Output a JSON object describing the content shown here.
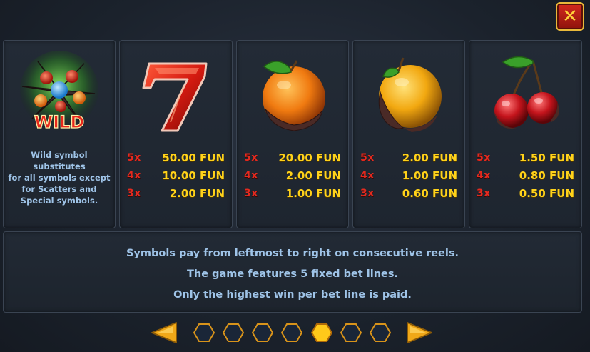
{
  "close": {
    "icon": "close-icon"
  },
  "wild": {
    "symbol_icon": "wild-symbol-icon",
    "label": "WILD",
    "description_lines": [
      "Wild symbol substitutes",
      "for all symbols except",
      "for Scatters and",
      "Special symbols."
    ]
  },
  "symbols": [
    {
      "icon": "seven-symbol-icon",
      "pays": [
        {
          "mult": "5x",
          "amount": "50.00 FUN"
        },
        {
          "mult": "4x",
          "amount": "10.00 FUN"
        },
        {
          "mult": "3x",
          "amount": "2.00 FUN"
        }
      ]
    },
    {
      "icon": "orange-symbol-icon",
      "pays": [
        {
          "mult": "5x",
          "amount": "20.00 FUN"
        },
        {
          "mult": "4x",
          "amount": "2.00 FUN"
        },
        {
          "mult": "3x",
          "amount": "1.00 FUN"
        }
      ]
    },
    {
      "icon": "lemon-symbol-icon",
      "pays": [
        {
          "mult": "5x",
          "amount": "2.00 FUN"
        },
        {
          "mult": "4x",
          "amount": "1.00 FUN"
        },
        {
          "mult": "3x",
          "amount": "0.60 FUN"
        }
      ]
    },
    {
      "icon": "cherry-symbol-icon",
      "pays": [
        {
          "mult": "5x",
          "amount": "1.50 FUN"
        },
        {
          "mult": "4x",
          "amount": "0.80 FUN"
        },
        {
          "mult": "3x",
          "amount": "0.50 FUN"
        }
      ]
    }
  ],
  "info_lines": [
    "Symbols pay from leftmost to right on consecutive reels.",
    "The game features 5 fixed bet lines.",
    "Only the highest win per bet line is paid."
  ],
  "pagination": {
    "total_pages": 7,
    "current_page": 5
  },
  "colors": {
    "multiplier": "#e52a1f",
    "amount": "#ffd21a",
    "info_text": "#9fc4e8",
    "active_dot": "#ffc91a"
  }
}
